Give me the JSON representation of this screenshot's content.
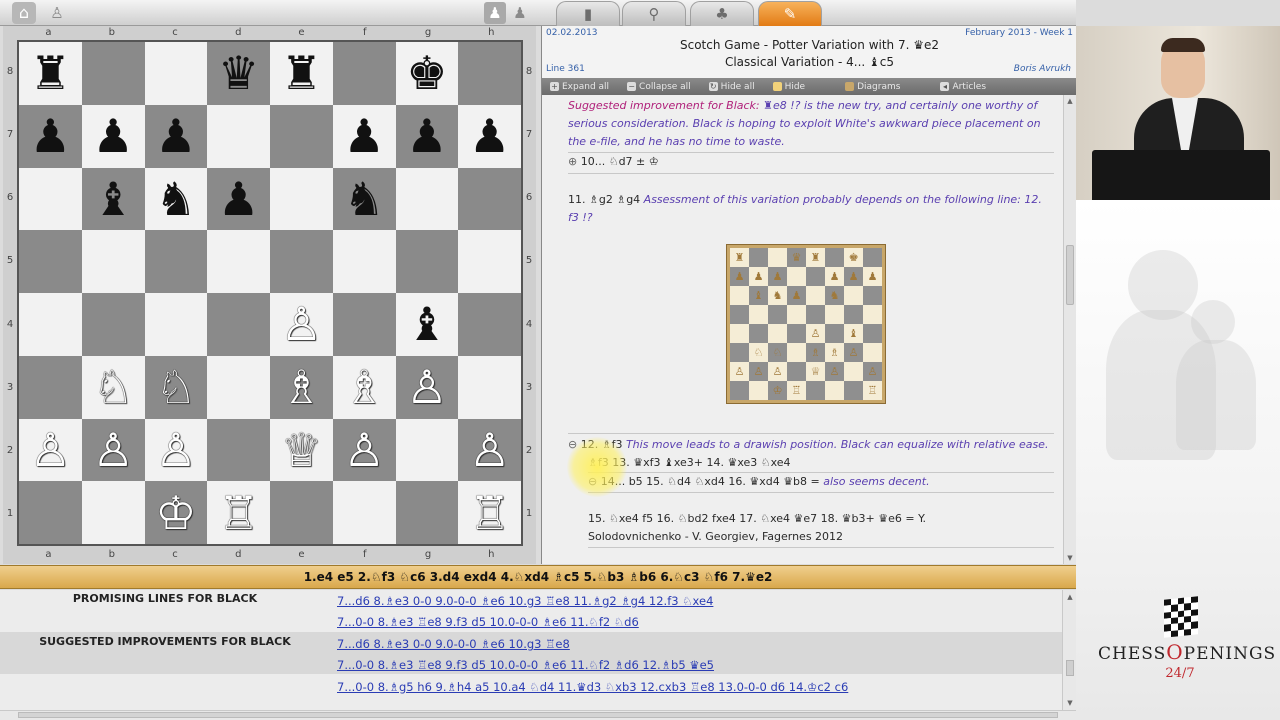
{
  "board": {
    "files": [
      "a",
      "b",
      "c",
      "d",
      "e",
      "f",
      "g",
      "h"
    ],
    "ranks": [
      "8",
      "7",
      "6",
      "5",
      "4",
      "3",
      "2",
      "1"
    ],
    "squares": [
      [
        {
          "p": "♜",
          "c": "b"
        },
        {
          "p": "",
          "c": ""
        },
        {
          "p": "",
          "c": ""
        },
        {
          "p": "♛",
          "c": "b"
        },
        {
          "p": "♜",
          "c": "b"
        },
        {
          "p": "",
          "c": ""
        },
        {
          "p": "♚",
          "c": "b"
        },
        {
          "p": "",
          "c": ""
        }
      ],
      [
        {
          "p": "♟",
          "c": "b"
        },
        {
          "p": "♟",
          "c": "b"
        },
        {
          "p": "♟",
          "c": "b"
        },
        {
          "p": "",
          "c": ""
        },
        {
          "p": "",
          "c": ""
        },
        {
          "p": "♟",
          "c": "b"
        },
        {
          "p": "♟",
          "c": "b"
        },
        {
          "p": "♟",
          "c": "b"
        }
      ],
      [
        {
          "p": "",
          "c": ""
        },
        {
          "p": "♝",
          "c": "b"
        },
        {
          "p": "♞",
          "c": "b"
        },
        {
          "p": "♟",
          "c": "b"
        },
        {
          "p": "",
          "c": ""
        },
        {
          "p": "♞",
          "c": "b"
        },
        {
          "p": "",
          "c": ""
        },
        {
          "p": "",
          "c": ""
        }
      ],
      [
        {
          "p": "",
          "c": ""
        },
        {
          "p": "",
          "c": ""
        },
        {
          "p": "",
          "c": ""
        },
        {
          "p": "",
          "c": ""
        },
        {
          "p": "",
          "c": ""
        },
        {
          "p": "",
          "c": ""
        },
        {
          "p": "",
          "c": ""
        },
        {
          "p": "",
          "c": ""
        }
      ],
      [
        {
          "p": "",
          "c": ""
        },
        {
          "p": "",
          "c": ""
        },
        {
          "p": "",
          "c": ""
        },
        {
          "p": "",
          "c": ""
        },
        {
          "p": "♙",
          "c": "w"
        },
        {
          "p": "",
          "c": ""
        },
        {
          "p": "♝",
          "c": "b"
        },
        {
          "p": "",
          "c": ""
        }
      ],
      [
        {
          "p": "",
          "c": ""
        },
        {
          "p": "♘",
          "c": "w"
        },
        {
          "p": "♘",
          "c": "w"
        },
        {
          "p": "",
          "c": ""
        },
        {
          "p": "♗",
          "c": "w"
        },
        {
          "p": "♗",
          "c": "w"
        },
        {
          "p": "♙",
          "c": "w"
        },
        {
          "p": "",
          "c": ""
        }
      ],
      [
        {
          "p": "♙",
          "c": "w"
        },
        {
          "p": "♙",
          "c": "w"
        },
        {
          "p": "♙",
          "c": "w"
        },
        {
          "p": "",
          "c": ""
        },
        {
          "p": "♕",
          "c": "w"
        },
        {
          "p": "♙",
          "c": "w"
        },
        {
          "p": "",
          "c": ""
        },
        {
          "p": "♙",
          "c": "w"
        }
      ],
      [
        {
          "p": "",
          "c": ""
        },
        {
          "p": "",
          "c": ""
        },
        {
          "p": "♔",
          "c": "w"
        },
        {
          "p": "♖",
          "c": "w"
        },
        {
          "p": "",
          "c": ""
        },
        {
          "p": "",
          "c": ""
        },
        {
          "p": "",
          "c": ""
        },
        {
          "p": "♖",
          "c": "w"
        }
      ]
    ]
  },
  "panel": {
    "date": "02.02.2013",
    "week": "February 2013 - Week 1",
    "title_line1": "Scotch Game - Potter Variation with 7. ♛e2",
    "title_line2": "Classical Variation - 4... ♝c5",
    "line_no": "Line 361",
    "author": "Boris Avrukh",
    "toolbar": {
      "expand": "Expand all",
      "collapse": "Collapse all",
      "hide_all": "Hide all",
      "hide": "Hide",
      "diagrams": "Diagrams",
      "articles": "Articles"
    },
    "note1_label": "Suggested improvement for Black:",
    "note1_text": " ♜e8 !? is the new try, and certainly one worthy of serious consideration. Black is hoping to exploit White's awkward piece placement on the e-file, and he has no time to waste.",
    "note2": "10... ♘d7 ± ♔",
    "note3_moves": "11. ♗g2 ♗g4",
    "note3_text": " Assessment of this variation probably depends on the following line: 12. f3 !?",
    "note4_moves": "12. ♗f3",
    "note4_text": " This move leads to a drawish position. Black can equalize with relative ease.",
    "note5": "♗f3 13. ♛xf3 ♝xe3+ 14. ♛xe3 ♘xe4",
    "note6_moves": "14... b5 15. ♘d4 ♘xd4 16. ♛xd4 ♛b8 =",
    "note6_text": " also seems decent.",
    "note7": "15. ♘xe4 f5 16. ♘bd2 fxe4 17. ♘xe4 ♛e7 18. ♛b3+ ♛e6 = Y. Solodovnichenko - V. Georgiev, Fagernes 2012",
    "mini": [
      [
        "♜",
        "",
        "",
        "♛",
        "♜",
        "",
        "♚",
        ""
      ],
      [
        "♟",
        "♟",
        "♟",
        "",
        "",
        "♟",
        "♟",
        "♟"
      ],
      [
        "",
        "♝",
        "♞",
        "♟",
        "",
        "♞",
        "",
        ""
      ],
      [
        "",
        "",
        "",
        "",
        "",
        "",
        "",
        ""
      ],
      [
        "",
        "",
        "",
        "",
        "♙",
        "",
        "♝",
        ""
      ],
      [
        "",
        "♘",
        "♘",
        "",
        "♗",
        "♗",
        "♙",
        ""
      ],
      [
        "♙",
        "♙",
        "♙",
        "",
        "♕",
        "♙",
        "",
        "♙"
      ],
      [
        "",
        "",
        "♔",
        "♖",
        "",
        "",
        "",
        "♖"
      ]
    ]
  },
  "movebar": "1.e4 e5 2.♘f3 ♘c6 3.d4 exd4 4.♘xd4 ♗c5 5.♘b3 ♗b6 6.♘c3 ♘f6 7.♛e2",
  "lines": {
    "promising_head": "PROMISING LINES FOR BLACK",
    "promising": [
      "7...d6 8.♗e3 0-0 9.0-0-0 ♗e6 10.g3 ♖e8 11.♗g2 ♗g4 12.f3 ♘xe4",
      "7...0-0 8.♗e3 ♖e8 9.f3 d5 10.0-0-0 ♗e6 11.♘f2 ♘d6"
    ],
    "suggested_head": "SUGGESTED IMPROVEMENTS FOR BLACK",
    "suggested": [
      "7...d6 8.♗e3 0-0 9.0-0-0 ♗e6 10.g3 ♖e8",
      "7...0-0 8.♗e3 ♖e8 9.f3 d5 10.0-0-0 ♗e6 11.♘f2 ♗d6 12.♗b5 ♛e5",
      "7...0-0 8.♗g5 h6 9.♗h4 a5 10.a4 ♘d4 11.♛d3 ♘xb3 12.cxb3 ♖e8 13.0-0-0 d6 14.♔c2 c6"
    ]
  },
  "logo": {
    "word1": "CHESS",
    "word2": "PENINGS",
    "sub": "24/7"
  },
  "colors": {
    "accent_orange": "#e27b15",
    "link_blue": "#2a3cb4",
    "note_purple": "#5a3fb0",
    "logo_red": "#c0282e"
  },
  "icons": {
    "home": "home-icon",
    "back": "back-icon",
    "user": "user-icon",
    "users": "users-icon",
    "book": "book-icon",
    "search": "search-icon",
    "tree": "tree-icon",
    "feather": "feather-icon"
  }
}
